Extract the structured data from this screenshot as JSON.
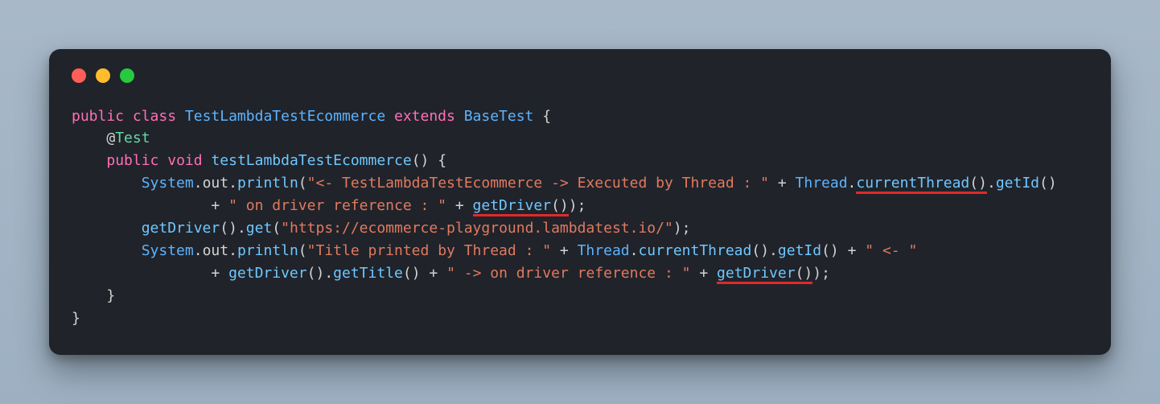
{
  "code": {
    "line1": {
      "kw_public": "public",
      "kw_class": "class",
      "className": "TestLambdaTestEcommerce",
      "kw_extends": "extends",
      "superClass": "BaseTest",
      "brace": "{"
    },
    "line2": {
      "annotation_at": "@",
      "annotation_name": "Test"
    },
    "line3": {
      "kw_public": "public",
      "kw_void": "void",
      "methodName": "testLambdaTestEcommerce",
      "parens": "()",
      "brace": "{"
    },
    "line4": {
      "System": "System",
      "dot1": ".",
      "out": "out",
      "dot2": ".",
      "println": "println",
      "open": "(",
      "str1": "\"<- TestLambdaTestEcommerce -> Executed by Thread : \"",
      "plus1": " + ",
      "Thread": "Thread",
      "dot3": ".",
      "currentThread": "currentThread",
      "ctparens": "()",
      "dot4": ".",
      "getId": "getId",
      "gidparens": "()"
    },
    "line5": {
      "plus1": "+ ",
      "str1": "\" on driver reference : \"",
      "plus2": " + ",
      "getDriver": "getDriver",
      "gdparens": "()",
      "close": ");"
    },
    "line6": {
      "getDriver": "getDriver",
      "gdparens": "()",
      "dot1": ".",
      "get": "get",
      "open": "(",
      "url": "\"https://ecommerce-playground.lambdatest.io/\"",
      "close": ");"
    },
    "line7": {
      "System": "System",
      "dot1": ".",
      "out": "out",
      "dot2": ".",
      "println": "println",
      "open": "(",
      "str1": "\"Title printed by Thread : \"",
      "plus1": " + ",
      "Thread": "Thread",
      "dot3": ".",
      "currentThread": "currentThread",
      "ctparens": "()",
      "dot4": ".",
      "getId": "getId",
      "gidparens": "()",
      "plus2": " + ",
      "str2": "\" <- \""
    },
    "line8": {
      "plus1": "+ ",
      "getDriver1": "getDriver",
      "gd1parens": "()",
      "dot1": ".",
      "getTitle": "getTitle",
      "gtparens": "()",
      "plus2": " + ",
      "str1": "\" -> on driver reference : \"",
      "plus3": " + ",
      "getDriver2": "getDriver",
      "gd2parens": "()",
      "close": ");"
    },
    "line9": {
      "brace": "}"
    },
    "line10": {
      "brace": "}"
    }
  }
}
